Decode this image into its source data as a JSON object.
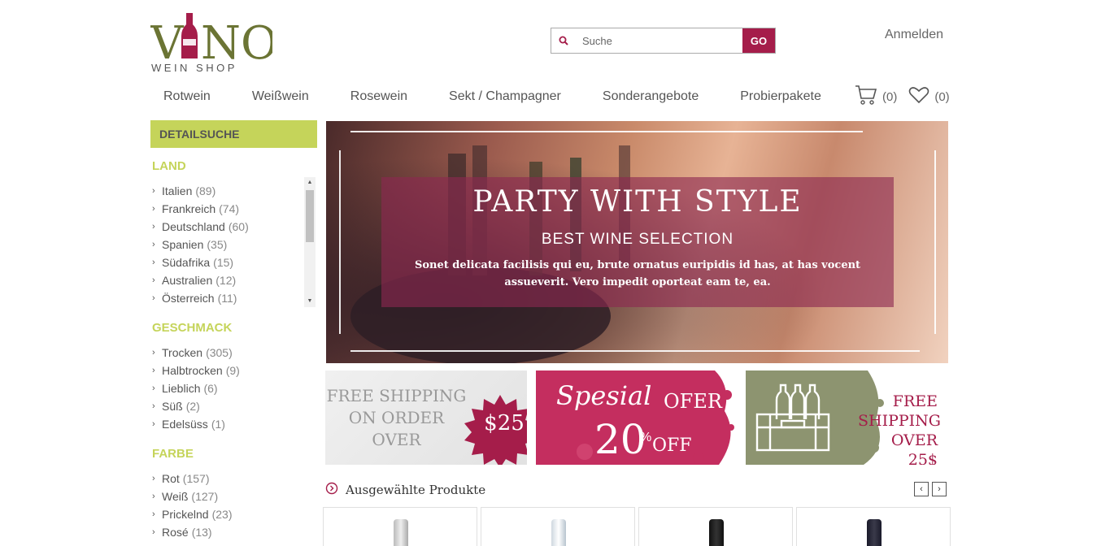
{
  "brand": {
    "name": "VINO",
    "tagline": "WEIN SHOP"
  },
  "search": {
    "placeholder": "Suche",
    "button": "GO"
  },
  "header": {
    "login": "Anmelden",
    "cart_count": "(0)",
    "wishlist_count": "(0)"
  },
  "nav": [
    "Rotwein",
    "Weißwein",
    "Rosewein",
    "Sekt / Champagner",
    "Sonderangebote",
    "Probierpakete"
  ],
  "sidebar": {
    "heading": "DETAILSUCHE",
    "facets": [
      {
        "title": "LAND",
        "items": [
          {
            "label": "Italien",
            "count": "(89)"
          },
          {
            "label": "Frankreich",
            "count": "(74)"
          },
          {
            "label": "Deutschland",
            "count": "(60)"
          },
          {
            "label": "Spanien",
            "count": "(35)"
          },
          {
            "label": "Südafrika",
            "count": "(15)"
          },
          {
            "label": "Australien",
            "count": "(12)"
          },
          {
            "label": "Österreich",
            "count": "(11)"
          }
        ]
      },
      {
        "title": "GESCHMACK",
        "items": [
          {
            "label": "Trocken",
            "count": "(305)"
          },
          {
            "label": "Halbtrocken",
            "count": "(9)"
          },
          {
            "label": "Lieblich",
            "count": "(6)"
          },
          {
            "label": "Süß",
            "count": "(2)"
          },
          {
            "label": "Edelsüss",
            "count": "(1)"
          }
        ]
      },
      {
        "title": "FARBE",
        "items": [
          {
            "label": "Rot",
            "count": "(157)"
          },
          {
            "label": "Weiß",
            "count": "(127)"
          },
          {
            "label": "Prickelnd",
            "count": "(23)"
          },
          {
            "label": "Rosé",
            "count": "(13)"
          }
        ]
      }
    ]
  },
  "hero": {
    "title": "PARTY WITH STYLE",
    "subtitle": "BEST WINE SELECTION",
    "text": "Sonet delicata facilisis qui eu, brute ornatus euripidis id has, at has vocent assueverit. Vero impedit oporteat eam te, ea."
  },
  "promos": {
    "p1": {
      "line1": "FREE SHIPPING",
      "line2": "ON ORDER",
      "line3": "OVER",
      "price": "$25"
    },
    "p2": {
      "word1": "Spesial",
      "word2": "OFER",
      "number": "20",
      "percent": "%",
      "off": "OFF"
    },
    "p3": {
      "line1": "FREE",
      "line2": "SHIPPING",
      "line3": "OVER 25$"
    }
  },
  "featured": {
    "title": "Ausgewählte Produkte"
  },
  "colors": {
    "accent": "#a51d4a",
    "green": "#c5d45a",
    "olive": "#6b7434"
  }
}
